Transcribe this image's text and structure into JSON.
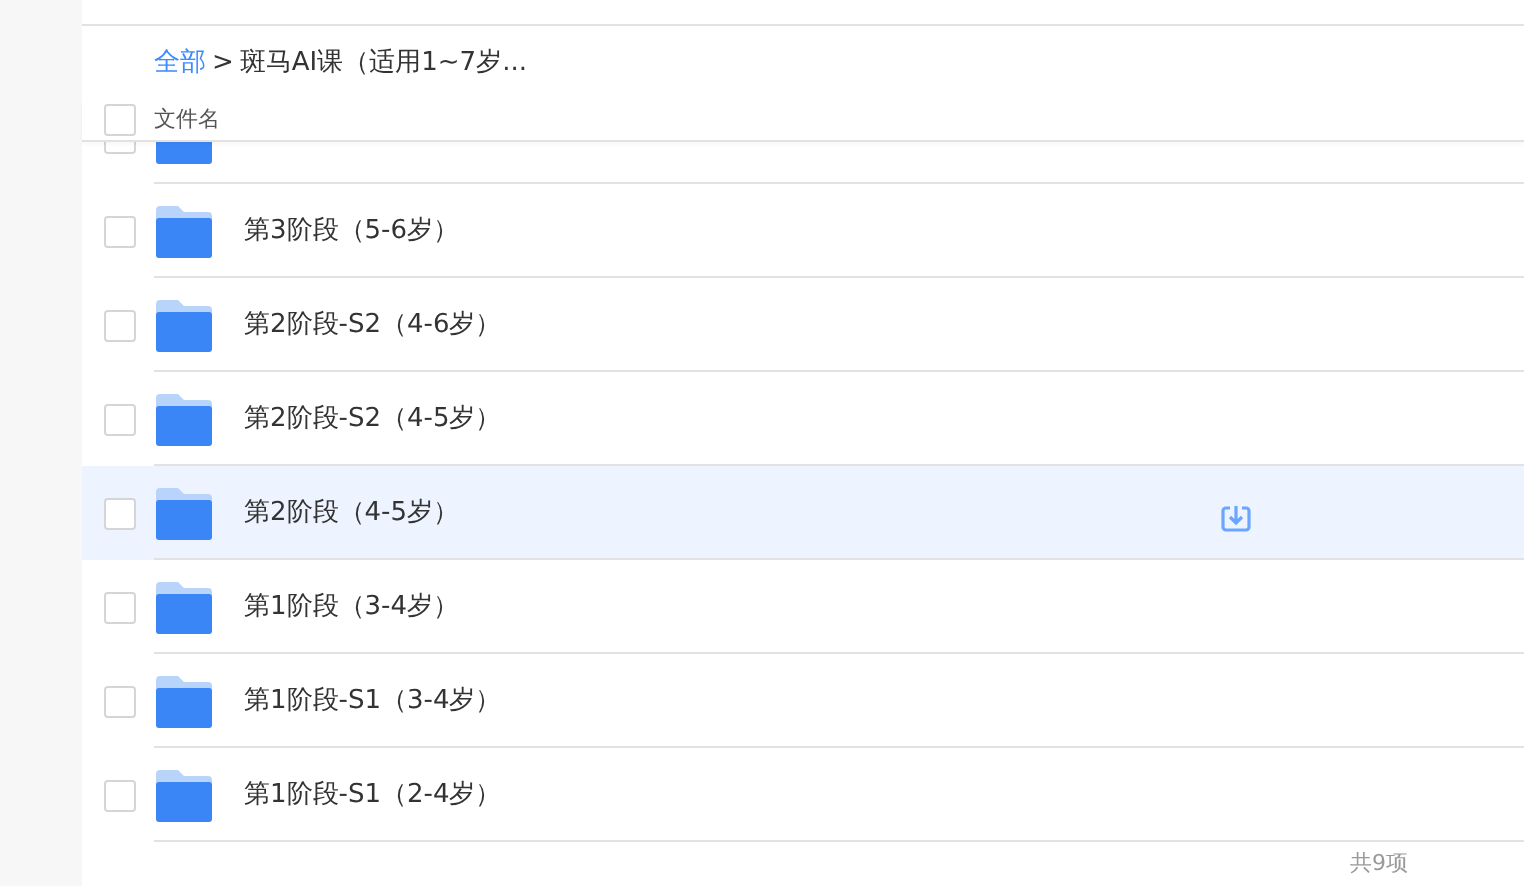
{
  "breadcrumb_separator": ">",
  "breadcrumb": [
    {
      "label": "全部",
      "kind": "link"
    },
    {
      "label": "斑马AI课（适用1~7岁...",
      "kind": "current"
    }
  ],
  "header": {
    "checked": false,
    "column_1": "文件名"
  },
  "partial_row": {
    "checked": false
  },
  "rows": [
    {
      "name": "第3阶段（5-6岁）",
      "checked": false,
      "hovered": false
    },
    {
      "name": "第2阶段-S2（4-6岁）",
      "checked": false,
      "hovered": false
    },
    {
      "name": "第2阶段-S2（4-5岁）",
      "checked": false,
      "hovered": false
    },
    {
      "name": "第2阶段（4-5岁）",
      "checked": false,
      "hovered": true
    },
    {
      "name": "第1阶段（3-4岁）",
      "checked": false,
      "hovered": false
    },
    {
      "name": "第1阶段-S1（3-4岁）",
      "checked": false,
      "hovered": false
    },
    {
      "name": "第1阶段-S1（2-4岁）",
      "checked": false,
      "hovered": false
    }
  ],
  "footer": {
    "count": "共9项"
  }
}
